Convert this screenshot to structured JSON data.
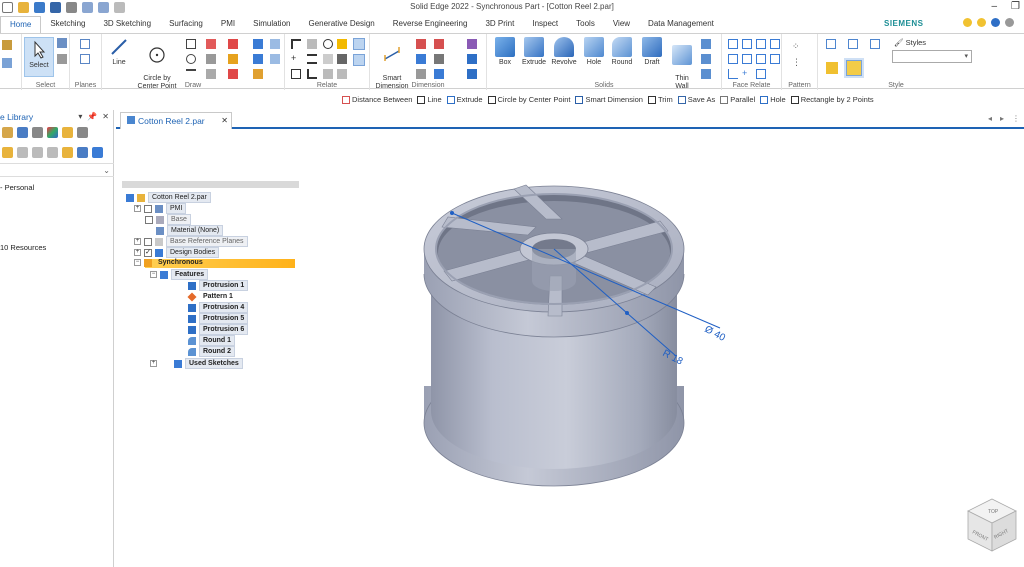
{
  "window": {
    "title": "Solid Edge 2022 - Synchronous Part - [Cotton Reel 2.par]",
    "brand": "SIEMENS"
  },
  "tabs": [
    {
      "label": "Home",
      "active": true
    },
    {
      "label": "Sketching"
    },
    {
      "label": "3D Sketching"
    },
    {
      "label": "Surfacing"
    },
    {
      "label": "PMI"
    },
    {
      "label": "Simulation"
    },
    {
      "label": "Generative Design"
    },
    {
      "label": "Reverse Engineering"
    },
    {
      "label": "3D Print"
    },
    {
      "label": "Inspect"
    },
    {
      "label": "Tools"
    },
    {
      "label": "View"
    },
    {
      "label": "Data Management"
    }
  ],
  "ribbon": {
    "select": {
      "button": "Select",
      "label": "Select"
    },
    "planes": {
      "label": "Planes"
    },
    "draw": {
      "line": "Line",
      "circle": "Circle by\nCenter Point",
      "label": "Draw"
    },
    "relate": {
      "label": "Relate"
    },
    "dimension": {
      "smart": "Smart\nDimension",
      "label": "Dimension"
    },
    "solids": {
      "box": "Box",
      "extrude": "Extrude",
      "revolve": "Revolve",
      "hole": "Hole",
      "round": "Round",
      "draft": "Draft",
      "thinwall": "Thin\nWall",
      "label": "Solids"
    },
    "face_relate": {
      "label": "Face Relate"
    },
    "pattern": {
      "label": "Pattern"
    },
    "style": {
      "styles": "Styles",
      "label": "Style"
    }
  },
  "command_bar": [
    "Distance Between",
    "Line",
    "Extrude",
    "Circle by Center Point",
    "Smart Dimension",
    "Trim",
    "Save As",
    "Parallel",
    "Hole",
    "Rectangle by 2 Points"
  ],
  "library": {
    "title": "e Library",
    "personal": "- Personal",
    "resources": "10 Resources"
  },
  "document_tab": {
    "label": "Cotton Reel 2.par"
  },
  "tree": {
    "root": "Cotton Reel 2.par",
    "pmi": "PMI",
    "base": "Base",
    "material": "Material (None)",
    "base_planes": "Base Reference Planes",
    "design_bodies": "Design Bodies",
    "synchronous": "Synchronous",
    "features": "Features",
    "items": [
      "Protrusion 1",
      "Pattern 1",
      "Protrusion 4",
      "Protrusion 5",
      "Protrusion 6",
      "Round 1",
      "Round 2"
    ],
    "used_sketches": "Used Sketches"
  },
  "dimensions": {
    "diameter": "Ø 40",
    "radius": "R 18"
  },
  "viewcube": {
    "front": "FRONT",
    "right": "RIGHT",
    "top": "TOP"
  },
  "colors": {
    "accent": "#1e63b4",
    "sync_highlight": "#ffbe2e",
    "part": "#a9afc0",
    "dim": "#1f5fc4"
  }
}
